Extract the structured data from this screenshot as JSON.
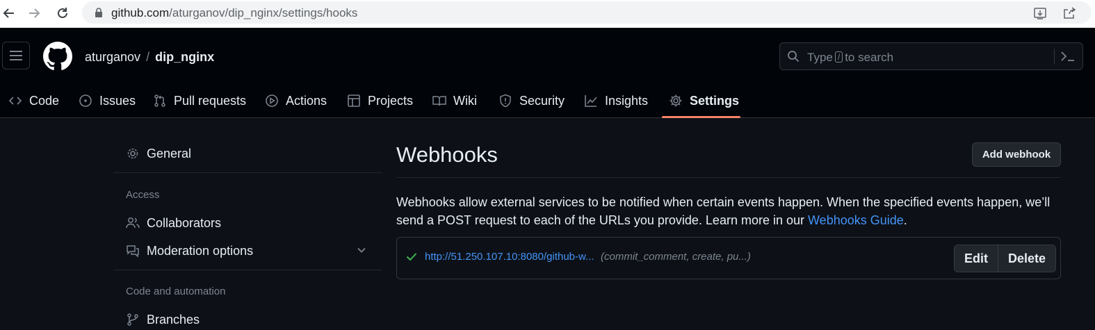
{
  "browser": {
    "url_host": "github.com",
    "url_path": "/aturganov/dip_nginx/settings/hooks",
    "icons": [
      "back-arrow-icon",
      "forward-arrow-icon",
      "reload-icon",
      "lock-icon",
      "install-icon",
      "share-icon"
    ]
  },
  "header": {
    "owner": "aturganov",
    "separator": "/",
    "repo": "dip_nginx",
    "search": {
      "prefix": "Type",
      "key": "/",
      "suffix": "to search"
    }
  },
  "repo_nav": {
    "tabs": [
      {
        "label": "Code",
        "icon": "code-icon"
      },
      {
        "label": "Issues",
        "icon": "issue-icon"
      },
      {
        "label": "Pull requests",
        "icon": "pull-request-icon"
      },
      {
        "label": "Actions",
        "icon": "play-icon"
      },
      {
        "label": "Projects",
        "icon": "table-icon"
      },
      {
        "label": "Wiki",
        "icon": "book-icon"
      },
      {
        "label": "Security",
        "icon": "shield-icon"
      },
      {
        "label": "Insights",
        "icon": "graph-icon"
      },
      {
        "label": "Settings",
        "icon": "gear-icon",
        "active": true
      }
    ]
  },
  "sidebar": {
    "general": "General",
    "access_heading": "Access",
    "collaborators": "Collaborators",
    "moderation": "Moderation options",
    "code_heading": "Code and automation",
    "branches": "Branches"
  },
  "main": {
    "title": "Webhooks",
    "add_button": "Add webhook",
    "description": "Webhooks allow external services to be notified when certain events happen. When the specified events happen, we’ll send a POST request to each of the URLs you provide. Learn more in our",
    "guide_link": "Webhooks Guide",
    "guide_after": ".",
    "hook": {
      "url": "http://51.250.107.10:8080/github-w...",
      "events": "(commit_comment, create, pu...)",
      "status": "success"
    },
    "edit_button": "Edit",
    "delete_button": "Delete"
  },
  "colors": {
    "background": "#0d1117",
    "header": "#010409",
    "accent_underline": "#f78166",
    "link": "#4493f8",
    "success": "#3fb950"
  }
}
